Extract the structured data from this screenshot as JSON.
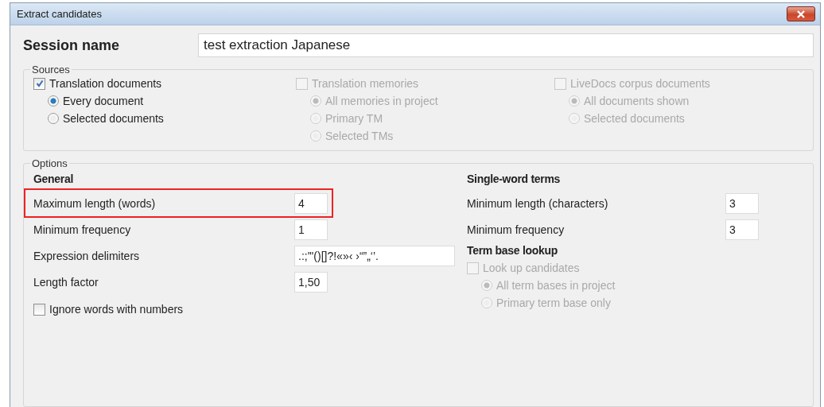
{
  "window": {
    "title": "Extract candidates"
  },
  "session": {
    "label": "Session name",
    "value": "test extraction Japanese"
  },
  "sources": {
    "title": "Sources",
    "columns": [
      {
        "label": "Translation documents",
        "checked": true,
        "disabled": false,
        "options": [
          {
            "label": "Every document",
            "selected": true
          },
          {
            "label": "Selected documents",
            "selected": false
          }
        ]
      },
      {
        "label": "Translation memories",
        "checked": false,
        "disabled": true,
        "options": [
          {
            "label": "All memories in project",
            "selected": true
          },
          {
            "label": "Primary TM",
            "selected": false
          },
          {
            "label": "Selected TMs",
            "selected": false
          }
        ]
      },
      {
        "label": "LiveDocs corpus documents",
        "checked": false,
        "disabled": true,
        "options": [
          {
            "label": "All documents shown",
            "selected": true
          },
          {
            "label": "Selected documents",
            "selected": false
          }
        ]
      }
    ]
  },
  "options": {
    "title": "Options",
    "general": {
      "heading": "General",
      "fields": [
        {
          "label": "Maximum length (words)",
          "value": "4",
          "kind": "short",
          "highlighted": true
        },
        {
          "label": "Minimum frequency",
          "value": "1",
          "kind": "short",
          "highlighted": false
        },
        {
          "label": "Expression delimiters",
          "value": ".:;'\"()[]?!«»‹ ›“”„‘’.",
          "kind": "wide",
          "highlighted": false
        },
        {
          "label": "Length factor",
          "value": "1,50",
          "kind": "short",
          "highlighted": false
        }
      ],
      "ignore_numbers": {
        "label": "Ignore words with numbers",
        "checked": false
      }
    },
    "single_word": {
      "heading": "Single-word terms",
      "fields": [
        {
          "label": "Minimum length (characters)",
          "value": "3"
        },
        {
          "label": "Minimum frequency",
          "value": "3"
        }
      ]
    },
    "term_base": {
      "heading": "Term base lookup",
      "lookup": {
        "label": "Look up candidates",
        "checked": false,
        "disabled": true
      },
      "options": [
        {
          "label": "All term bases in project",
          "selected": true
        },
        {
          "label": "Primary term base only",
          "selected": false
        }
      ]
    }
  }
}
